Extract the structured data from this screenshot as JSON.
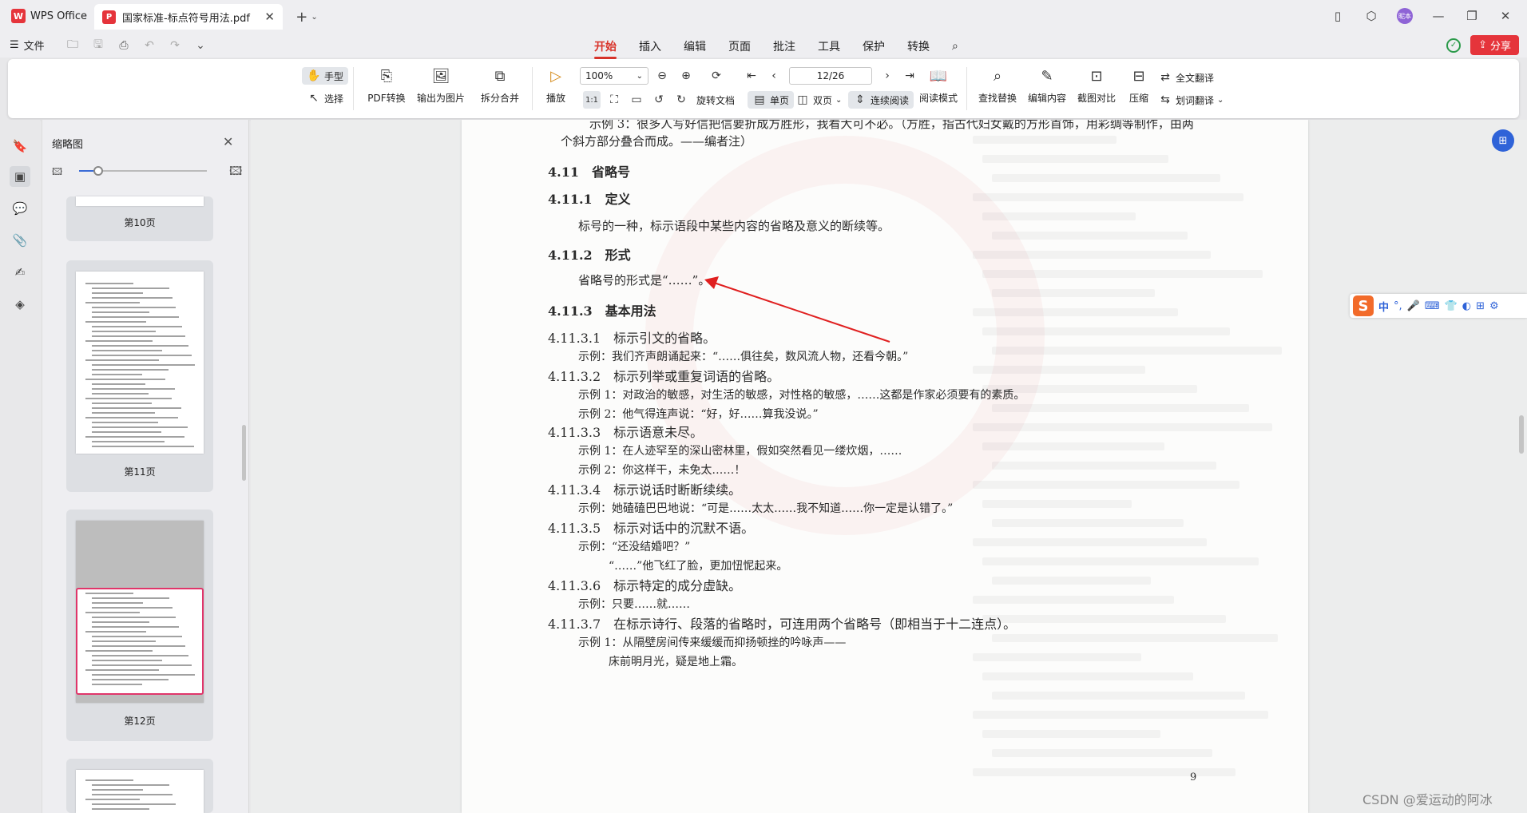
{
  "titlebar": {
    "app_name": "WPS Office",
    "doc_tab": "国家标准-标点符号用法.pdf",
    "avatar_text": "昵本"
  },
  "menubar": {
    "file_label": "文件",
    "tabs": [
      "开始",
      "插入",
      "编辑",
      "页面",
      "批注",
      "工具",
      "保护",
      "转换"
    ],
    "active_tab": "开始",
    "share_label": "分享"
  },
  "ribbon": {
    "hand_label": "手型",
    "select_label": "选择",
    "pdf_convert": "PDF转换",
    "export_image": "输出为图片",
    "split_merge": "拆分合并",
    "play": "播放",
    "zoom": "100%",
    "rotate": "旋转文档",
    "single_page": "单页",
    "double_page": "双页",
    "continuous": "连续阅读",
    "page_indicator": "12/26",
    "read_mode": "阅读模式",
    "find_replace": "查找替换",
    "edit_content": "编辑内容",
    "screenshot_compare": "截图对比",
    "compress": "压缩",
    "full_translate": "全文翻译",
    "word_translate": "划词翻译"
  },
  "thumbnails": {
    "title": "缩略图",
    "pages": [
      "第10页",
      "第11页",
      "第12页"
    ]
  },
  "document": {
    "line_top": "示例 3：很多人写好信把信要折成方胜形，我看大可不必。（方胜，指古代妇女戴的方形首饰，用彩绸等制作，由两",
    "line_top2": "个斜方部分叠合而成。——编者注）",
    "h_411": "4.11　省略号",
    "h_4111": "4.11.1　定义",
    "def_text": "标号的一种，标示语段中某些内容的省略及意义的断续等。",
    "h_4112": "4.11.2　形式",
    "form_text": "省略号的形式是“……”。",
    "h_4113": "4.11.3　基本用法",
    "h_41131": "4.11.3.1　标示引文的省略。",
    "ex_1": "示例：我们齐声朗诵起来：“……俱往矣，数风流人物，还看今朝。”",
    "h_41132": "4.11.3.2　标示列举或重复词语的省略。",
    "ex_2a": "示例 1：对政治的敏感，对生活的敏感，对性格的敏感，……这都是作家必须要有的素质。",
    "ex_2b": "示例 2：他气得连声说：“好，好……算我没说。”",
    "h_41133": "4.11.3.3　标示语意未尽。",
    "ex_3a": "示例 1：在人迹罕至的深山密林里，假如突然看见一缕炊烟，……",
    "ex_3b": "示例 2：你这样干，未免太……！",
    "h_41134": "4.11.3.4　标示说话时断断续续。",
    "ex_4": "示例：她磕磕巴巴地说：“可是……太太……我不知道……你一定是认错了。”",
    "h_41135": "4.11.3.5　标示对话中的沉默不语。",
    "ex_5a": "示例：“还没结婚吧？”",
    "ex_5b": "“……”他飞红了脸，更加忸怩起来。",
    "h_41136": "4.11.3.6　标示特定的成分虚缺。",
    "ex_6": "示例：只要……就……",
    "h_41137": "4.11.3.7　在标示诗行、段落的省略时，可连用两个省略号（即相当于十二连点）。",
    "ex_7a": "示例 1：从隔壁房间传来缓缓而抑扬顿挫的吟咏声——",
    "ex_7b": "床前明月光，疑是地上霜。",
    "page_number": "9"
  },
  "ime": {
    "mode": "中"
  },
  "watermark_text": "CSDN @爱运动的阿冰",
  "colors": {
    "accent": "#d9342b",
    "brand_red": "#e5343b",
    "arrow_red": "#e02020"
  }
}
